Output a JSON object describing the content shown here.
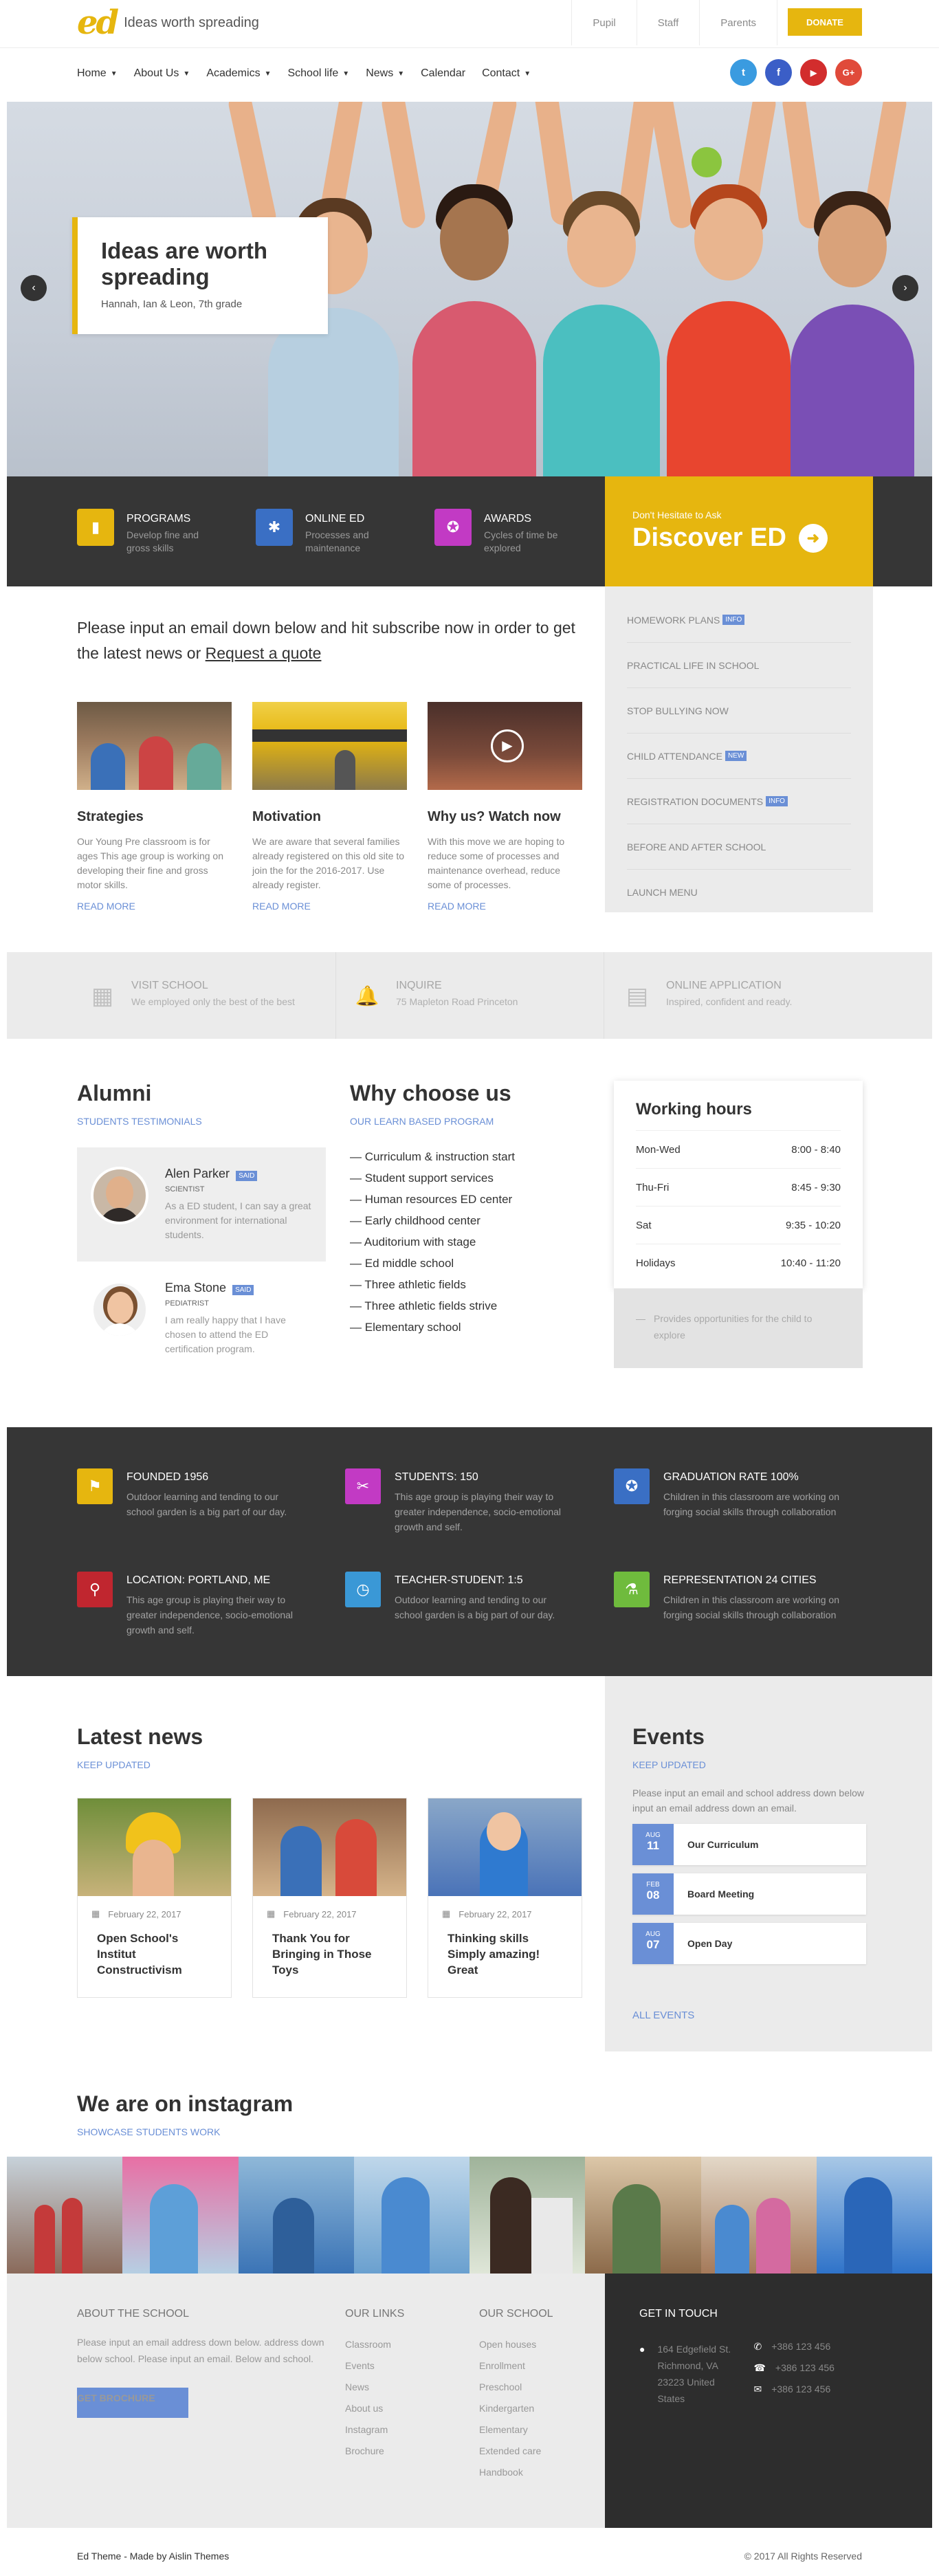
{
  "header": {
    "logo_mark": "ed",
    "tagline": "Ideas worth spreading",
    "top_links": [
      "Pupil",
      "Staff",
      "Parents"
    ],
    "donate": "DONATE"
  },
  "nav": {
    "items": [
      "Home",
      "About Us",
      "Academics",
      "School life",
      "News",
      "Calendar",
      "Contact"
    ],
    "social": [
      "twitter-icon",
      "facebook-icon",
      "youtube-icon",
      "google-plus-icon"
    ],
    "social_glyphs": [
      "t",
      "f",
      "▶",
      "G+"
    ]
  },
  "hero": {
    "title": "Ideas are worth spreading",
    "caption": "Hannah, Ian & Leon, 7th grade",
    "prev": "‹",
    "next": "›"
  },
  "features": [
    {
      "title": "PROGRAMS",
      "text": "Develop fine and gross skills",
      "color": "#e6b60f",
      "icon": "book-icon",
      "glyph": "▮"
    },
    {
      "title": "ONLINE ED",
      "text": "Processes and maintenance",
      "color": "#3a6fc4",
      "icon": "bug-icon",
      "glyph": "✱"
    },
    {
      "title": "AWARDS",
      "text": "Cycles of time be explored",
      "color": "#c23ac4",
      "icon": "award-icon",
      "glyph": "✪"
    }
  ],
  "discover": {
    "small": "Don't Hesitate to Ask",
    "big": "Discover ED",
    "arrow": "➜"
  },
  "intro": {
    "lead": "Please input an email down below and hit subscribe now in order to get the latest news or",
    "link": "Request a quote"
  },
  "cards": [
    {
      "title": "Strategies",
      "text": "Our Young Pre classroom is for ages This age group is working on developing their fine and gross motor skills.",
      "more": "READ MORE"
    },
    {
      "title": "Motivation",
      "text": "We are aware that several families already registered on this old site to join the for the 2016-2017. Use already register.",
      "more": "READ MORE"
    },
    {
      "title": "Why us? Watch now",
      "text": "With this move we are hoping to reduce some of processes and maintenance overhead, reduce some of processes.",
      "more": "READ MORE"
    }
  ],
  "sidemenu": [
    {
      "label": "HOMEWORK PLANS",
      "badge": "INFO"
    },
    {
      "label": "PRACTICAL LIFE IN SCHOOL",
      "badge": ""
    },
    {
      "label": "STOP BULLYING NOW",
      "badge": ""
    },
    {
      "label": "CHILD ATTENDANCE",
      "badge": "NEW"
    },
    {
      "label": "REGISTRATION DOCUMENTS",
      "badge": "INFO"
    },
    {
      "label": "BEFORE AND AFTER SCHOOL",
      "badge": ""
    },
    {
      "label": "LAUNCH MENU",
      "badge": ""
    }
  ],
  "infostrip": [
    {
      "title": "VISIT SCHOOL",
      "text": "We employed only the best of the best",
      "icon": "calendar-icon",
      "glyph": "▦"
    },
    {
      "title": "INQUIRE",
      "text": "75 Mapleton Road Princeton",
      "icon": "bell-icon",
      "glyph": "🔔"
    },
    {
      "title": "ONLINE APPLICATION",
      "text": "Inspired, confident and ready.",
      "icon": "form-icon",
      "glyph": "▤"
    }
  ],
  "alumni": {
    "title": "Alumni",
    "sub": "STUDENTS TESTIMONIALS",
    "items": [
      {
        "name": "Alen Parker",
        "badge": "SAID",
        "role": "SCIENTIST",
        "text": "As a ED student, I can say a great environment for international students."
      },
      {
        "name": "Ema Stone",
        "badge": "SAID",
        "role": "PEDIATRIST",
        "text": "I am really happy that I have chosen to attend the ED certification program."
      }
    ]
  },
  "why": {
    "title": "Why choose us",
    "sub": "OUR LEARN BASED PROGRAM",
    "items": [
      "Curriculum & instruction start",
      "Student support services",
      "Human resources ED center",
      "Early childhood center",
      "Auditorium with stage",
      "Ed middle school",
      "Three athletic fields",
      "Three athletic fields strive",
      "Elementary school"
    ]
  },
  "hours": {
    "title": "Working hours",
    "rows": [
      [
        "Mon-Wed",
        "8:00 - 8:40"
      ],
      [
        "Thu-Fri",
        "8:45 - 9:30"
      ],
      [
        "Sat",
        "9:35 - 10:20"
      ],
      [
        "Holidays",
        "10:40 - 11:20"
      ]
    ],
    "note": "Provides opportunities for the child to explore"
  },
  "stats": [
    {
      "title": "FOUNDED 1956",
      "text": "Outdoor learning and tending to our school garden is a big part of our day.",
      "color": "#e6b60f",
      "icon": "flag-icon",
      "glyph": "⚑"
    },
    {
      "title": "STUDENTS: 150",
      "text": "This age group is playing their way to greater independence, socio-emotional growth and self.",
      "color": "#c23ac4",
      "icon": "tools-icon",
      "glyph": "✂"
    },
    {
      "title": "GRADUATION RATE 100%",
      "text": "Children in this classroom are working on forging social skills through collaboration",
      "color": "#3a6fc4",
      "icon": "medal-icon",
      "glyph": "✪"
    },
    {
      "title": "LOCATION: PORTLAND, ME",
      "text": "This age group is playing their way to greater independence, socio-emotional growth and self.",
      "color": "#c0262f",
      "icon": "map-pin-icon",
      "glyph": "⚲"
    },
    {
      "title": "TEACHER-STUDENT: 1:5",
      "text": "Outdoor learning and tending to our school garden is a big part of our day.",
      "color": "#3a98d6",
      "icon": "clock-icon",
      "glyph": "◷"
    },
    {
      "title": "REPRESENTATION 24 CITIES",
      "text": "Children in this classroom are working on forging social skills through collaboration",
      "color": "#6fbb3d",
      "icon": "flask-icon",
      "glyph": "⚗"
    }
  ],
  "news": {
    "title": "Latest news",
    "sub": "KEEP UPDATED",
    "items": [
      {
        "date": "February 22, 2017",
        "title": "Open School's Institut Constructivism"
      },
      {
        "date": "February 22, 2017",
        "title": "Thank You for Bringing in Those Toys"
      },
      {
        "date": "February 22, 2017",
        "title": "Thinking skills Simply amazing! Great"
      }
    ]
  },
  "events": {
    "title": "Events",
    "sub": "KEEP UPDATED",
    "desc": "Please input an email and school address down below input an email address down an email.",
    "items": [
      {
        "month": "AUG",
        "day": "11",
        "title": "Our Curriculum"
      },
      {
        "month": "FEB",
        "day": "08",
        "title": "Board Meeting"
      },
      {
        "month": "AUG",
        "day": "07",
        "title": "Open Day"
      }
    ],
    "all": "ALL EVENTS"
  },
  "instagram": {
    "title": "We are on instagram",
    "sub": "SHOWCASE STUDENTS WORK"
  },
  "footer": {
    "about_title": "ABOUT THE SCHOOL",
    "about_text": "Please input an email address down below. address down below school. Please input an email. Below and school.",
    "brochure": "GET BROCHURE",
    "links_title": "OUR LINKS",
    "links": [
      "Classroom",
      "Events",
      "News",
      "About us",
      "Instagram",
      "Brochure"
    ],
    "school_title": "OUR SCHOOL",
    "school": [
      "Open houses",
      "Enrollment",
      "Preschool",
      "Kindergarten",
      "Elementary",
      "Extended care",
      "Handbook"
    ],
    "touch_title": "GET IN TOUCH",
    "address": "164 Edgefield St. Richmond, VA 23223 United States",
    "phones": [
      "+386 123 456",
      "+386 123 456",
      "+386 123 456"
    ],
    "made_by": "Ed Theme - Made by Aislin Themes",
    "copyright": "© 2017 All Rights Reserved"
  },
  "colors": {
    "accent": "#e6b60f",
    "link": "#6a8fd6",
    "dark": "#363636"
  }
}
